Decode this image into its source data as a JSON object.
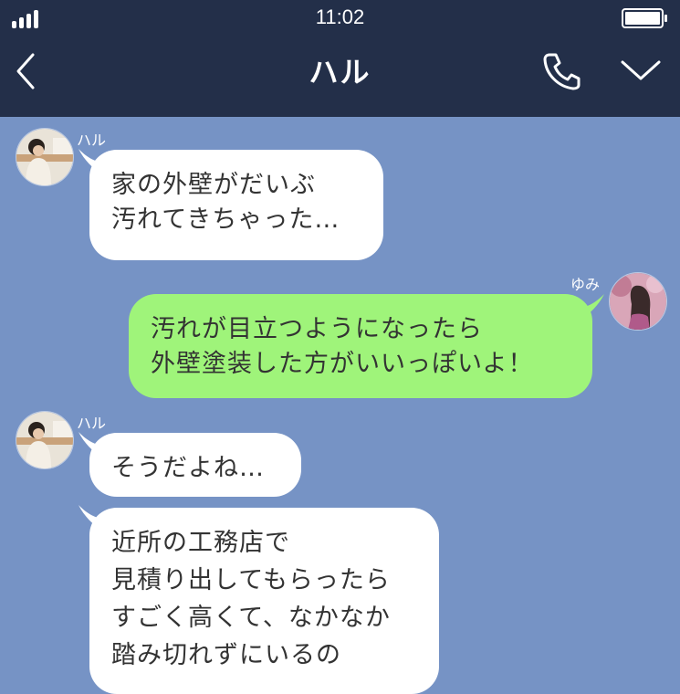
{
  "status_bar": {
    "time": "11:02"
  },
  "header": {
    "title": "ハル"
  },
  "messages": [
    {
      "sender": "ハル",
      "side": "left",
      "lines": [
        "家の外壁がだいぶ",
        "汚れてきちゃった…"
      ]
    },
    {
      "sender": "ゆみ",
      "side": "right",
      "lines": [
        "汚れが目立つようになったら",
        "外壁塗装した方がいいっぽいよ！"
      ]
    },
    {
      "sender": "ハル",
      "side": "left",
      "lines": [
        "そうだよね…"
      ]
    },
    {
      "sender": "",
      "side": "left",
      "lines": [
        "近所の工務店で",
        "見積り出してもらったら",
        "すごく高くて、なかなか",
        "踏み切れずにいるの"
      ]
    }
  ],
  "colors": {
    "header_bg": "#232f49",
    "chat_bg": "#7693c5",
    "incoming_bubble": "#ffffff",
    "outgoing_bubble": "#9ff47a"
  },
  "icons": [
    "signal-icon",
    "battery-icon",
    "back-arrow-icon",
    "phone-icon",
    "chevron-down-icon"
  ]
}
